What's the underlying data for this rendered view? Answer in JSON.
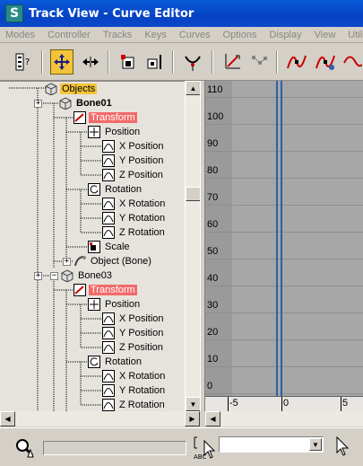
{
  "window": {
    "title": "Track View - Curve Editor",
    "app_icon": "3ds-max-icon"
  },
  "menu": [
    "Modes",
    "Controller",
    "Tracks",
    "Keys",
    "Curves",
    "Options",
    "Display",
    "View",
    "Utilities"
  ],
  "toolbar": {
    "buttons": [
      "filters-icon",
      "move-keys-icon",
      "slide-keys-icon",
      "scale-keys-icon",
      "scale-values-icon",
      "insert-keys-icon",
      "draw-curves-icon",
      "reduce-keys-icon",
      "tangent-auto-icon",
      "tangent-custom-icon",
      "tangent-fast-icon"
    ]
  },
  "tree": {
    "root": "Objects",
    "nodes": [
      {
        "label": "Bone01",
        "kind": "object",
        "bold": true
      },
      {
        "label": "Transform",
        "kind": "transform",
        "highlight": true
      },
      {
        "label": "Position",
        "kind": "position"
      },
      {
        "label": "X Position",
        "kind": "track"
      },
      {
        "label": "Y Position",
        "kind": "track"
      },
      {
        "label": "Z Position",
        "kind": "track"
      },
      {
        "label": "Rotation",
        "kind": "rotation"
      },
      {
        "label": "X Rotation",
        "kind": "track"
      },
      {
        "label": "Y Rotation",
        "kind": "track"
      },
      {
        "label": "Z Rotation",
        "kind": "track"
      },
      {
        "label": "Scale",
        "kind": "scale"
      },
      {
        "label": "Object (Bone)",
        "kind": "objectbone"
      },
      {
        "label": "Bone03",
        "kind": "object",
        "bold": false
      },
      {
        "label": "Transform",
        "kind": "transform",
        "highlight": true
      },
      {
        "label": "Position",
        "kind": "position"
      },
      {
        "label": "X Position",
        "kind": "track"
      },
      {
        "label": "Y Position",
        "kind": "track"
      },
      {
        "label": "Z Position",
        "kind": "track"
      },
      {
        "label": "Rotation",
        "kind": "rotation"
      },
      {
        "label": "X Rotation",
        "kind": "track"
      },
      {
        "label": "Y Rotation",
        "kind": "track"
      },
      {
        "label": "Z Rotation",
        "kind": "track"
      }
    ]
  },
  "graph": {
    "y_labels": [
      "110",
      "100",
      "90",
      "80",
      "70",
      "60",
      "50",
      "40",
      "30",
      "20",
      "10",
      "0"
    ],
    "ruler_labels": [
      "-5",
      "0",
      "5"
    ],
    "current_frame": 0
  },
  "status": {
    "field_value": "",
    "dropdown_value": ""
  },
  "colors": {
    "titlebar": "#0542c4",
    "highlight": "#f26a6a",
    "selected_object": "#f3c43a",
    "frame_line": "#2f5fa8"
  }
}
